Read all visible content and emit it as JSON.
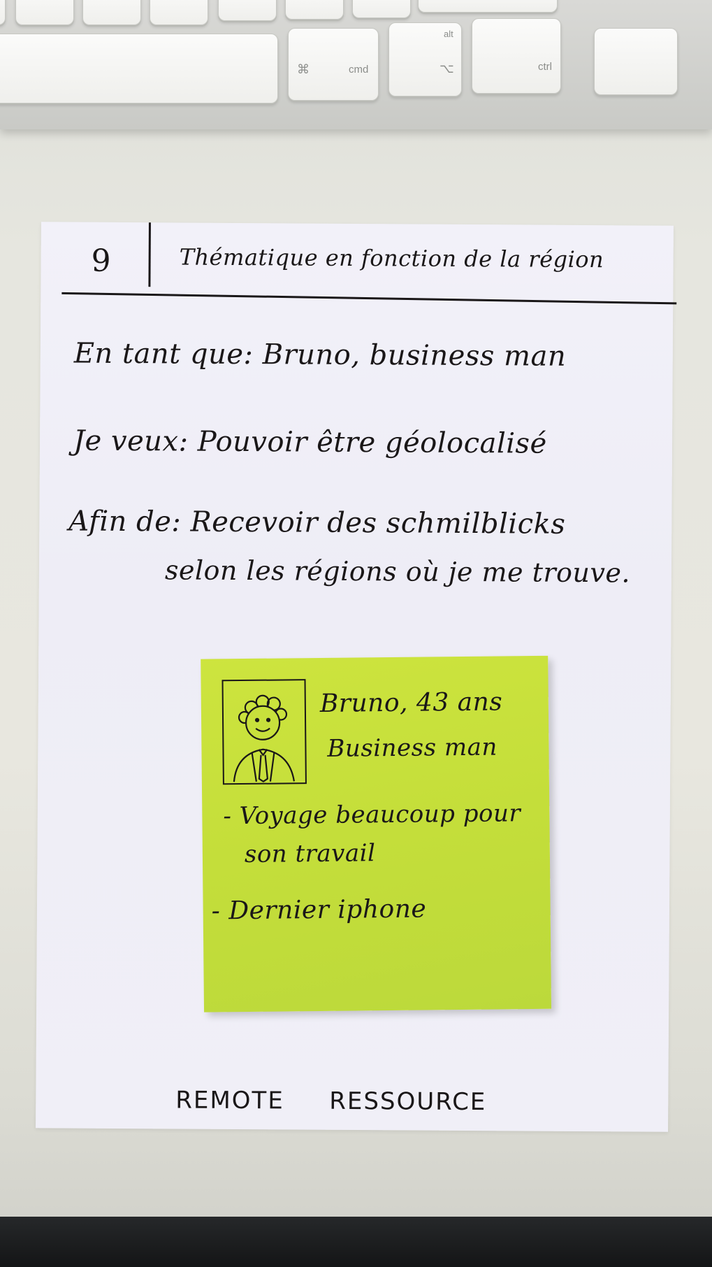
{
  "keyboard": {
    "keys": {
      "cmd_symbol": "⌘",
      "cmd": "cmd",
      "alt": "alt",
      "alt_symbol": "⌥",
      "ctrl": "ctrl"
    }
  },
  "card": {
    "number": "9",
    "title": "Thématique en fonction de la région",
    "as_a": "En tant que: Bruno, business man",
    "i_want": "Je veux: Pouvoir être géolocalisé",
    "so_that_line1": "Afin de: Recevoir des schmilblicks",
    "so_that_line2": "selon les régions où je me trouve.",
    "footer_left": "REMOTE",
    "footer_right": "RESSOURCE"
  },
  "sticky_note": {
    "name_age": "Bruno, 43 ans",
    "role": "Business man",
    "bullet1_line1": "- Voyage beaucoup pour",
    "bullet1_line2": "son travail",
    "bullet2": "- Dernier iphone"
  },
  "colors": {
    "sticky": "#c8e03c",
    "ink": "#1a1718",
    "paper": "#f0eff8"
  }
}
